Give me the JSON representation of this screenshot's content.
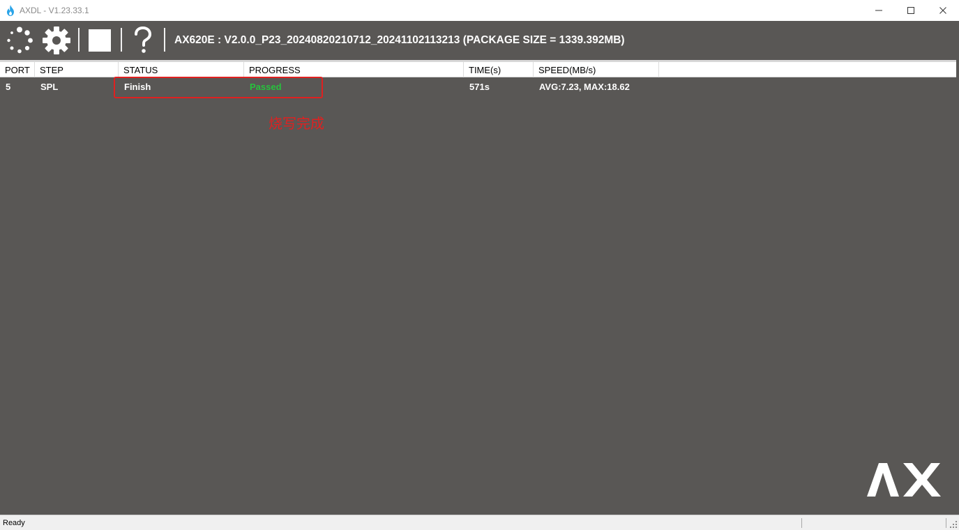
{
  "window": {
    "title": "AXDL - V1.23.33.1",
    "icon": "flame-icon",
    "controls": [
      "minimize-icon",
      "maximize-icon",
      "close-icon"
    ]
  },
  "toolbar": {
    "buttons": [
      {
        "name": "loading-spinner-icon"
      },
      {
        "name": "settings-gear-icon"
      },
      {
        "name": "stop-square-icon"
      },
      {
        "name": "help-question-icon"
      }
    ],
    "package_info": "AX620E : V2.0.0_P23_20240820210712_20241102113213 (PACKAGE SIZE = 1339.392MB)"
  },
  "table": {
    "columns": [
      "PORT",
      "STEP",
      "STATUS",
      "PROGRESS",
      "TIME(s)",
      "SPEED(MB/s)"
    ],
    "rows": [
      {
        "port": "5",
        "step": "SPL",
        "status": "Finish",
        "progress": "Passed",
        "time": "571s",
        "speed": "AVG:7.23, MAX:18.62"
      }
    ]
  },
  "annotation": "烧写完成",
  "logo": "AX",
  "status_bar": {
    "text": "Ready"
  },
  "colors": {
    "background": "#595755",
    "passed": "#27c23d",
    "annotation_red": "#e02020"
  }
}
